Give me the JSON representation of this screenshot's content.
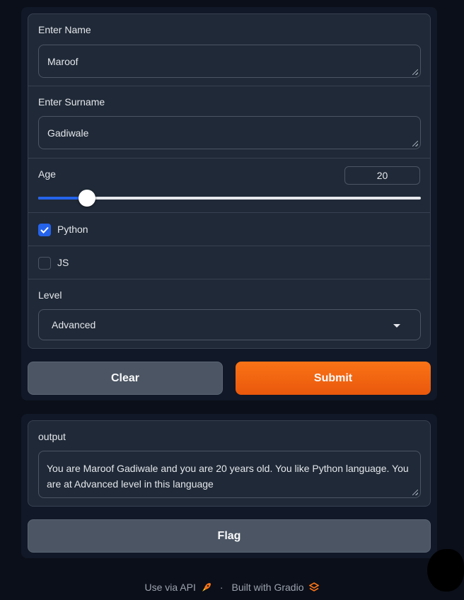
{
  "form": {
    "name": {
      "label": "Enter Name",
      "value": "Maroof"
    },
    "surname": {
      "label": "Enter Surname",
      "value": "Gadiwale"
    },
    "age": {
      "label": "Age",
      "value": "20",
      "fraction": 0.127
    },
    "checkboxes": [
      {
        "label": "Python",
        "checked": true
      },
      {
        "label": "JS",
        "checked": false
      }
    ],
    "level": {
      "label": "Level",
      "value": "Advanced"
    }
  },
  "buttons": {
    "clear": "Clear",
    "submit": "Submit",
    "flag": "Flag"
  },
  "output": {
    "label": "output",
    "value": "You are Maroof Gadiwale and you are 20 years old. You like Python language. You are at Advanced level in this language"
  },
  "footer": {
    "api_link": "Use via API",
    "separator": "·",
    "built_with": "Built with Gradio"
  },
  "icons": {
    "api": "rocket-icon",
    "gradio": "gradio-logo-icon"
  },
  "colors": {
    "accent": "#2563eb",
    "submit": "#f97316"
  }
}
